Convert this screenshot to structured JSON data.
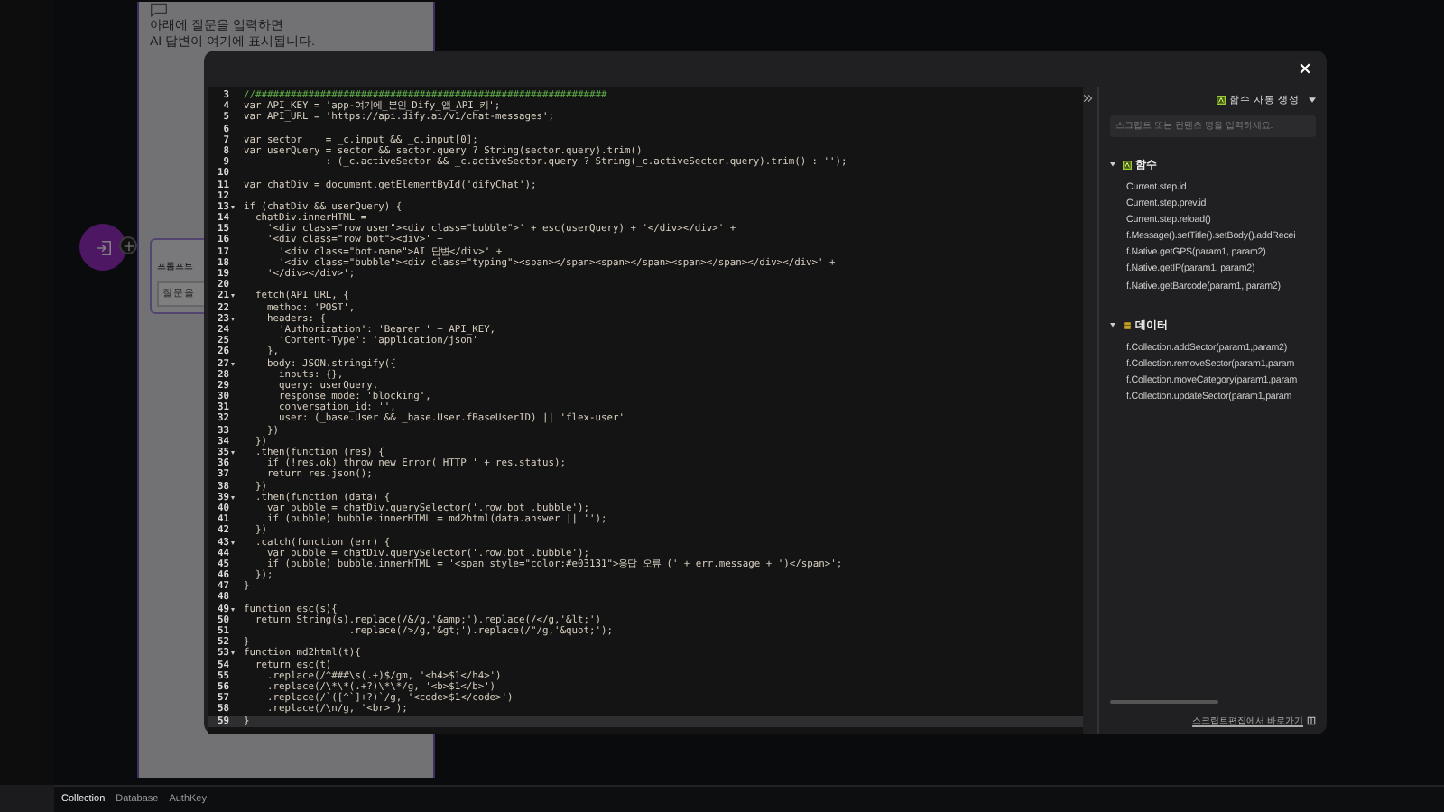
{
  "preview": {
    "lines": [
      "아래에 질문을 입력하면",
      "AI 답변이 여기에 표시됩니다."
    ],
    "prompt_label": "프롬프트",
    "prompt_placeholder": "질문을"
  },
  "bottom_tabs": [
    {
      "label": "Collection",
      "selected": true
    },
    {
      "label": "Database",
      "selected": false
    },
    {
      "label": "AuthKey",
      "selected": false
    }
  ],
  "editor": {
    "lines": [
      {
        "n": "3",
        "kind": "comment",
        "code": "//############################################################",
        "fold": false,
        "active": false
      },
      {
        "n": "4",
        "kind": "code",
        "code": "var API_KEY = 'app-여기에_본인_Dify_앱_API_키';",
        "fold": false,
        "active": false
      },
      {
        "n": "5",
        "kind": "code",
        "code": "var API_URL = 'https://api.dify.ai/v1/chat-messages';",
        "fold": false,
        "active": false
      },
      {
        "n": "6",
        "kind": "code",
        "fold": false,
        "active": false
      },
      {
        "n": "7",
        "kind": "code",
        "code": "var sector    = _c.input && _c.input[0];",
        "fold": false,
        "active": false
      },
      {
        "n": "8",
        "kind": "code",
        "code": "var userQuery = sector && sector.query ? String(sector.query).trim()",
        "fold": false,
        "active": false
      },
      {
        "n": "9",
        "kind": "code",
        "code": "              : (_c.activeSector && _c.activeSector.query ? String(_c.activeSector.query).trim() : '');",
        "fold": false,
        "active": false
      },
      {
        "n": "10",
        "kind": "code",
        "fold": false,
        "active": false
      },
      {
        "n": "11",
        "kind": "code",
        "code": "var chatDiv = document.getElementById('difyChat');",
        "fold": false,
        "active": false
      },
      {
        "n": "12",
        "kind": "code",
        "fold": false,
        "active": false
      },
      {
        "n": "13",
        "kind": "code",
        "code": "if (chatDiv && userQuery) {",
        "fold": true,
        "active": false
      },
      {
        "n": "14",
        "kind": "code",
        "code": "  chatDiv.innerHTML =",
        "fold": false,
        "active": false
      },
      {
        "n": "15",
        "kind": "code",
        "code": "    '<div class=\"row user\"><div class=\"bubble\">' + esc(userQuery) + '</div></div>' +",
        "fold": false,
        "active": false
      },
      {
        "n": "16",
        "kind": "code",
        "code": "    '<div class=\"row bot\"><div>' +",
        "fold": false,
        "active": false
      },
      {
        "n": "17",
        "kind": "code",
        "code": "      '<div class=\"bot-name\">AI 답변</div>' +",
        "fold": false,
        "active": false
      },
      {
        "n": "18",
        "kind": "code",
        "code": "      '<div class=\"bubble\"><div class=\"typing\"><span></span><span></span><span></span></div></div>' +",
        "fold": false,
        "active": false
      },
      {
        "n": "19",
        "kind": "code",
        "code": "    '</div></div>';",
        "fold": false,
        "active": false
      },
      {
        "n": "20",
        "kind": "code",
        "fold": false,
        "active": false
      },
      {
        "n": "21",
        "kind": "code",
        "code": "  fetch(API_URL, {",
        "fold": true,
        "active": false
      },
      {
        "n": "22",
        "kind": "code",
        "code": "    method: 'POST',",
        "fold": false,
        "active": false
      },
      {
        "n": "23",
        "kind": "code",
        "code": "    headers: {",
        "fold": true,
        "active": false
      },
      {
        "n": "24",
        "kind": "code",
        "code": "      'Authorization': 'Bearer ' + API_KEY,",
        "fold": false,
        "active": false
      },
      {
        "n": "25",
        "kind": "code",
        "code": "      'Content-Type': 'application/json'",
        "fold": false,
        "active": false
      },
      {
        "n": "26",
        "kind": "code",
        "code": "    },",
        "fold": false,
        "active": false
      },
      {
        "n": "27",
        "kind": "code",
        "code": "    body: JSON.stringify({",
        "fold": true,
        "active": false
      },
      {
        "n": "28",
        "kind": "code",
        "code": "      inputs: {},",
        "fold": false,
        "active": false
      },
      {
        "n": "29",
        "kind": "code",
        "code": "      query: userQuery,",
        "fold": false,
        "active": false
      },
      {
        "n": "30",
        "kind": "code",
        "code": "      response_mode: 'blocking',",
        "fold": false,
        "active": false
      },
      {
        "n": "31",
        "kind": "code",
        "code": "      conversation_id: '',",
        "fold": false,
        "active": false
      },
      {
        "n": "32",
        "kind": "code",
        "code": "      user: (_base.User && _base.User.fBaseUserID) || 'flex-user'",
        "fold": false,
        "active": false
      },
      {
        "n": "33",
        "kind": "code",
        "code": "    })",
        "fold": false,
        "active": false
      },
      {
        "n": "34",
        "kind": "code",
        "code": "  })",
        "fold": false,
        "active": false
      },
      {
        "n": "35",
        "kind": "code",
        "code": "  .then(function (res) {",
        "fold": true,
        "active": false
      },
      {
        "n": "36",
        "kind": "code",
        "code": "    if (!res.ok) throw new Error('HTTP ' + res.status);",
        "fold": false,
        "active": false
      },
      {
        "n": "37",
        "kind": "code",
        "code": "    return res.json();",
        "fold": false,
        "active": false
      },
      {
        "n": "38",
        "kind": "code",
        "code": "  })",
        "fold": false,
        "active": false
      },
      {
        "n": "39",
        "kind": "code",
        "code": "  .then(function (data) {",
        "fold": true,
        "active": false
      },
      {
        "n": "40",
        "kind": "code",
        "code": "    var bubble = chatDiv.querySelector('.row.bot .bubble');",
        "fold": false,
        "active": false
      },
      {
        "n": "41",
        "kind": "code",
        "code": "    if (bubble) bubble.innerHTML = md2html(data.answer || '');",
        "fold": false,
        "active": false
      },
      {
        "n": "42",
        "kind": "code",
        "code": "  })",
        "fold": false,
        "active": false
      },
      {
        "n": "43",
        "kind": "code",
        "code": "  .catch(function (err) {",
        "fold": true,
        "active": false
      },
      {
        "n": "44",
        "kind": "code",
        "code": "    var bubble = chatDiv.querySelector('.row.bot .bubble');",
        "fold": false,
        "active": false
      },
      {
        "n": "45",
        "kind": "code",
        "code": "    if (bubble) bubble.innerHTML = '<span style=\"color:#e03131\">응답 오류 (' + err.message + ')</span>';",
        "fold": false,
        "active": false
      },
      {
        "n": "46",
        "kind": "code",
        "code": "  });",
        "fold": false,
        "active": false
      },
      {
        "n": "47",
        "kind": "code",
        "code": "}",
        "fold": false,
        "active": false
      },
      {
        "n": "48",
        "kind": "code",
        "fold": false,
        "active": false
      },
      {
        "n": "49",
        "kind": "code",
        "code": "function esc(s){",
        "fold": true,
        "active": false
      },
      {
        "n": "50",
        "kind": "code",
        "code": "  return String(s).replace(/&/g,'&amp;').replace(/</g,'&lt;')",
        "fold": false,
        "active": false
      },
      {
        "n": "51",
        "kind": "code",
        "code": "                  .replace(/>/g,'&gt;').replace(/\"/g,'&quot;');",
        "fold": false,
        "active": false
      },
      {
        "n": "52",
        "kind": "code",
        "code": "}",
        "fold": false,
        "active": false
      },
      {
        "n": "53",
        "kind": "code",
        "code": "function md2html(t){",
        "fold": true,
        "active": false
      },
      {
        "n": "54",
        "kind": "code",
        "code": "  return esc(t)",
        "fold": false,
        "active": false
      },
      {
        "n": "55",
        "kind": "code",
        "code": "    .replace(/^###\\s(.+)$/gm, '<h4>$1</h4>')",
        "fold": false,
        "active": false
      },
      {
        "n": "56",
        "kind": "code",
        "code": "    .replace(/\\*\\*(.+?)\\*\\*/g, '<b>$1</b>')",
        "fold": false,
        "active": false
      },
      {
        "n": "57",
        "kind": "code",
        "code": "    .replace(/`([^`]+?)`/g, '<code>$1</code>')",
        "fold": false,
        "active": false
      },
      {
        "n": "58",
        "kind": "code",
        "code": "    .replace(/\\n/g, '<br>');",
        "fold": false,
        "active": false
      },
      {
        "n": "59",
        "kind": "code",
        "code": "}",
        "fold": false,
        "active": true
      }
    ]
  },
  "panel": {
    "generate_button": "함수 자동 생성",
    "search_placeholder": "스크립트 또는 컨텐츠 명을 입력하세요.",
    "sections": [
      {
        "kind": "functions",
        "title": "함수",
        "expanded": true,
        "items": [
          "Current.step.id",
          "Current.step.prev.id",
          "Current.step.reload()",
          "f.Message().setTitle().setBody().addRecei",
          "f.Native.getGPS(param1, param2)",
          "f.Native.getIP(param1, param2)",
          "f.Native.getBarcode(param1, param2)"
        ]
      },
      {
        "kind": "data",
        "title": "데이터",
        "expanded": true,
        "items": [
          "f.Collection.addSector(param1,param2)",
          "f.Collection.removeSector(param1,param",
          "f.Collection.moveCategory(param1,param",
          "f.Collection.updateSector(param1,param"
        ]
      }
    ],
    "footer_link": "스크립트편집에서 바로가기"
  }
}
